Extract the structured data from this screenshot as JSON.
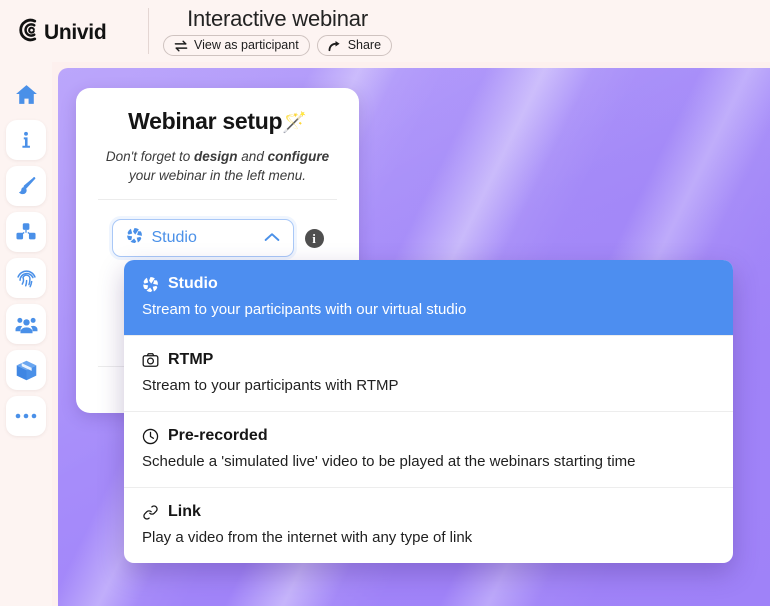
{
  "brand": {
    "name": "Univid",
    "logo_icon": "univid-swirl-logo"
  },
  "header": {
    "title": "Interactive webinar",
    "actions": [
      {
        "label": "View as participant",
        "icon": "swap-arrows-icon"
      },
      {
        "label": "Share",
        "icon": "share-arrow-icon"
      }
    ]
  },
  "sidebar": {
    "items": [
      {
        "name": "home",
        "icon": "home-icon"
      },
      {
        "name": "info",
        "icon": "info-icon"
      },
      {
        "name": "design",
        "icon": "paintbrush-icon"
      },
      {
        "name": "blocks",
        "icon": "cubes-icon"
      },
      {
        "name": "access",
        "icon": "fingerprint-icon"
      },
      {
        "name": "participants",
        "icon": "people-group-icon"
      },
      {
        "name": "integrations",
        "icon": "box-icon"
      },
      {
        "name": "more",
        "icon": "ellipsis-icon"
      }
    ]
  },
  "setup_card": {
    "title": "Webinar setup",
    "title_emoji": "🪄",
    "subtitle_parts": {
      "a": "Don't forget to ",
      "b": "design",
      "c": " and ",
      "d": "configure",
      "e": " your webinar in the left menu."
    },
    "select": {
      "value": "Studio",
      "icon": "aperture-icon",
      "chevron": "chevron-up-icon",
      "expanded": true
    },
    "info_button": {
      "label": "i",
      "icon": "info-circle-icon"
    }
  },
  "dropdown": {
    "options": [
      {
        "label": "Studio",
        "description": "Stream to your participants with our virtual studio",
        "icon": "aperture-icon",
        "selected": true
      },
      {
        "label": "RTMP",
        "description": "Stream to your participants with RTMP",
        "icon": "camera-icon",
        "selected": false
      },
      {
        "label": "Pre-recorded",
        "description": "Schedule a 'simulated live' video to be played at the webinars starting time",
        "icon": "clock-icon",
        "selected": false
      },
      {
        "label": "Link",
        "description": "Play a video from the internet with any type of link",
        "icon": "link-icon",
        "selected": false
      }
    ]
  },
  "colors": {
    "header_bg": "#fdf4f2",
    "stage_purple": "#a88ffa",
    "accent_blue": "#4a90e8",
    "highlight_blue": "#4d8ef0",
    "card_white": "#ffffff"
  }
}
